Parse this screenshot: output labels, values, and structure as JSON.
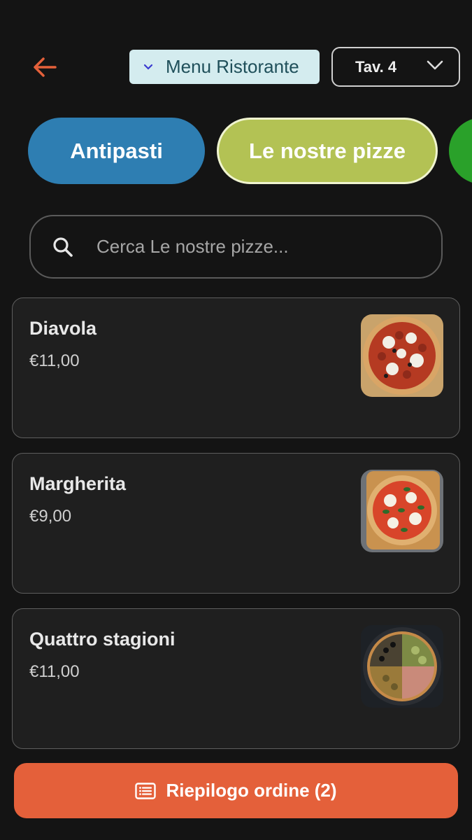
{
  "header": {
    "menu_label": "Menu Ristorante",
    "table_label": "Tav. 4"
  },
  "categories": [
    {
      "label": "Antipasti",
      "color": "#2e7eb2"
    },
    {
      "label": "Le nostre pizze",
      "color": "#b3c254",
      "selected": true
    },
    {
      "label": "",
      "color": "#2aa12a"
    }
  ],
  "search": {
    "placeholder": "Cerca Le nostre pizze...",
    "value": ""
  },
  "items": [
    {
      "name": "Diavola",
      "price": "€11,00",
      "image": "pizza-diavola"
    },
    {
      "name": "Margherita",
      "price": "€9,00",
      "image": "pizza-margherita"
    },
    {
      "name": "Quattro stagioni",
      "price": "€11,00",
      "image": "pizza-quattro-stagioni"
    }
  ],
  "summary_button": {
    "label": "Riepilogo ordine (2)"
  },
  "colors": {
    "background": "#141414",
    "accent": "#e4603a",
    "card": "#1f1f1f"
  },
  "icons": [
    "arrow-left-icon",
    "chevron-down-icon",
    "search-icon",
    "list-icon"
  ]
}
